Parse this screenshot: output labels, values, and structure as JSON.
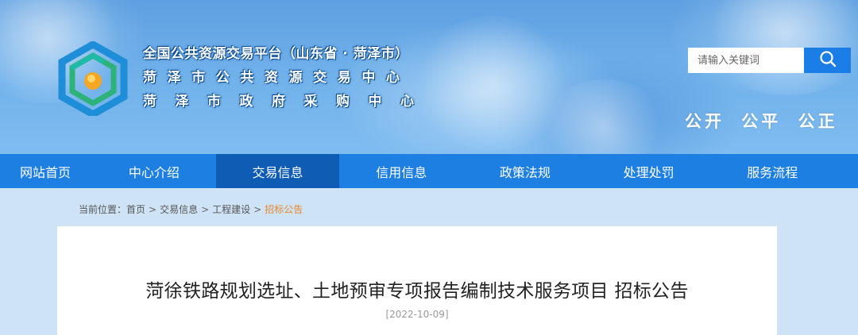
{
  "header": {
    "title_line1": "全国公共资源交易平台（山东省 · 菏泽市）",
    "title_line2": "菏泽市公共资源交易中心",
    "title_line3": "菏泽市政府采购中心",
    "slogan": "公开 公平 公正"
  },
  "search": {
    "placeholder": "请输入关键词",
    "icon": "search-icon"
  },
  "nav": {
    "items": [
      {
        "label": "网站首页"
      },
      {
        "label": "中心介绍"
      },
      {
        "label": "交易信息",
        "active": true
      },
      {
        "label": "信用信息"
      },
      {
        "label": "政策法规"
      },
      {
        "label": "处理处罚"
      },
      {
        "label": "服务流程"
      }
    ]
  },
  "breadcrumb": {
    "prefix": "当前位置：",
    "items": [
      "首页",
      "交易信息",
      "工程建设",
      "招标公告"
    ],
    "separator": ">"
  },
  "article": {
    "title": "菏徐铁路规划选址、土地预审专项报告编制技术服务项目 招标公告",
    "date": "[2022-10-09]"
  },
  "colors": {
    "nav_bg": "#1e7fe2",
    "nav_active": "#0e5cb4",
    "search_button": "#1a7ee6",
    "breadcrumb_current": "#e8862a"
  }
}
